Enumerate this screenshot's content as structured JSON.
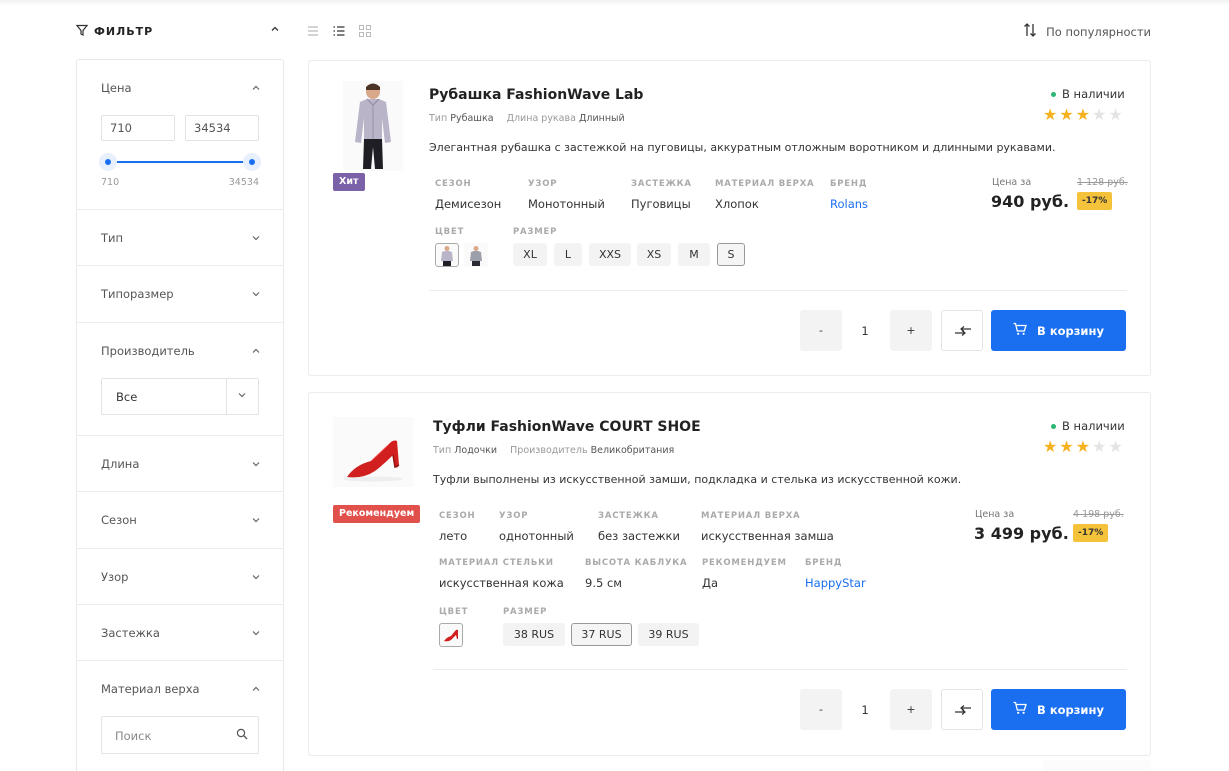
{
  "filter": {
    "title": "ФИЛЬТР",
    "price": {
      "label": "Цена",
      "min_value": "710",
      "max_value": "34534",
      "range_min_label": "710",
      "range_max_label": "34534"
    },
    "sections": [
      "Тип",
      "Типоразмер",
      "Производитель",
      "Длина",
      "Сезон",
      "Узор",
      "Застежка",
      "Материал верха"
    ],
    "manufacturer_select": "Все",
    "material_search_placeholder": "Поиск"
  },
  "toolbar": {
    "view_icons": [
      "list-icon",
      "detailed-list-icon",
      "grid-icon"
    ],
    "sort_label": "По популярности"
  },
  "products": [
    {
      "title": "Рубашка FashionWave Lab",
      "badge": "Хит",
      "badge_color": "#7b61a8",
      "props": [
        {
          "k": "Тип",
          "v": "Рубашка"
        },
        {
          "k": "Длина рукава",
          "v": "Длинный"
        }
      ],
      "description": "Элегантная рубашка с застежкой на пуговицы, аккуратным отложным воротником и длинными рукавами.",
      "stock": "В наличии",
      "rating": 3,
      "chars": [
        {
          "k": "СЕЗОН",
          "v": "Демисезон"
        },
        {
          "k": "УЗОР",
          "v": "Монотонный"
        },
        {
          "k": "ЗАСТЕЖКА",
          "v": "Пуговицы"
        },
        {
          "k": "МАТЕРИАЛ ВЕРХА",
          "v": "Хлопок"
        },
        {
          "k": "БРЕНД",
          "v": "Rolans"
        }
      ],
      "color_label": "ЦВЕТ",
      "size_label": "РАЗМЕР",
      "sizes": [
        "XL",
        "L",
        "XXS",
        "XS",
        "M",
        "S"
      ],
      "selected_size": "S",
      "price_label": "Цена за",
      "price": "940 руб.",
      "old_price": "1 128 руб.",
      "discount": "-17%",
      "qty": "1",
      "minus": "-",
      "plus": "+",
      "cart": "В корзину"
    },
    {
      "title": "Туфли FashionWave COURT SHOE",
      "badge": "Рекомендуем",
      "badge_color": "#e2504c",
      "props": [
        {
          "k": "Тип",
          "v": "Лодочки"
        },
        {
          "k": "Производитель",
          "v": "Великобритания"
        }
      ],
      "description": "Туфли выполнены из искусственной замши, подкладка и стелька из искусственной кожи.",
      "stock": "В наличии",
      "rating": 3,
      "chars": [
        {
          "k": "СЕЗОН",
          "v": "лето"
        },
        {
          "k": "УЗОР",
          "v": "однотонный"
        },
        {
          "k": "ЗАСТЕЖКА",
          "v": "без застежки"
        },
        {
          "k": "МАТЕРИАЛ ВЕРХА",
          "v": "искусственная замша"
        },
        {
          "k": "МАТЕРИАЛ СТЕЛЬКИ",
          "v": "искусственная кожа"
        },
        {
          "k": "ВЫСОТА КАБЛУКА",
          "v": "9.5 см"
        },
        {
          "k": "РЕКОМЕНДУЕМ",
          "v": "Да"
        },
        {
          "k": "БРЕНД",
          "v": "HappyStar"
        }
      ],
      "color_label": "ЦВЕТ",
      "size_label": "РАЗМЕР",
      "sizes": [
        "38 RUS",
        "37 RUS",
        "39 RUS"
      ],
      "selected_size": "37 RUS",
      "price_label": "Цена за",
      "price": "3 499 руб.",
      "old_price": "4 198 руб.",
      "discount": "-17%",
      "qty": "1",
      "minus": "-",
      "plus": "+",
      "cart": "В корзину"
    }
  ],
  "colors": {
    "accent": "#1a6ff0",
    "in_stock": "#2bb673",
    "star": "#f5b21d",
    "discount": "#f5c33b"
  }
}
